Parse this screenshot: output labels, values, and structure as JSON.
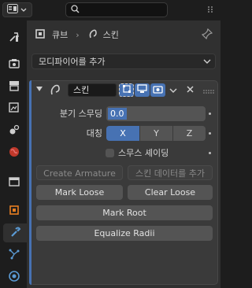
{
  "search": {
    "placeholder": "",
    "value": ""
  },
  "context": {
    "object_name": "큐브",
    "modifier_name": "스킨"
  },
  "add_modifier": {
    "label": "모디파이어를 추가"
  },
  "modifier": {
    "name": "스킨",
    "branch_smoothing": {
      "label": "분기 스무딩",
      "value": "0.0"
    },
    "symmetry": {
      "label": "대칭",
      "axes": [
        "X",
        "Y",
        "Z"
      ],
      "selected": "X"
    },
    "smooth_shading": {
      "label": "스무스 셰이딩",
      "checked": false
    },
    "buttons": {
      "create_armature": "Create Armature",
      "add_skin_data": "스킨 데이터를 추가",
      "mark_loose": "Mark Loose",
      "clear_loose": "Clear Loose",
      "mark_root": "Mark Root",
      "equalize_radii": "Equalize Radii"
    }
  },
  "colors": {
    "accent": "#4772b3",
    "panel": "#303030",
    "button": "#545454"
  },
  "icons": [
    "editor-type-icon",
    "search-icon",
    "pin-icon",
    "tool-icon",
    "render-icon",
    "output-icon",
    "view-layer-icon",
    "scene-icon",
    "world-icon",
    "collection-icon",
    "object-icon",
    "modifier-icon",
    "particles-icon",
    "physics-icon",
    "cube-icon",
    "skin-modifier-icon"
  ]
}
